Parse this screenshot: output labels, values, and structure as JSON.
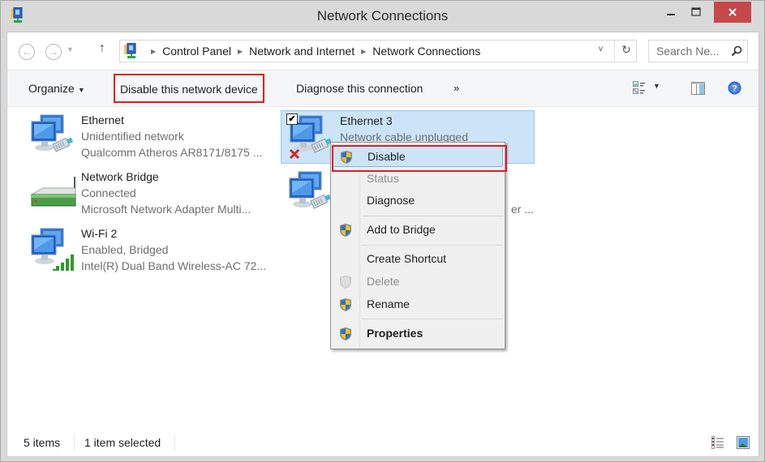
{
  "window": {
    "title": "Network Connections",
    "controls": {
      "minimize": "–",
      "maximize": "□",
      "close": "✕"
    },
    "close_color": "#c7484a"
  },
  "address": {
    "back_glyph": "←",
    "forward_glyph": "→",
    "recent_glyph": "▼",
    "up_glyph": "↑",
    "breadcrumbs": [
      "Control Panel",
      "Network and Internet",
      "Network Connections"
    ],
    "separator_glyph": "▶",
    "dropdown_glyph": "v",
    "refresh_glyph": "↻",
    "search_placeholder": "Search Ne..."
  },
  "toolbar": {
    "organize": "Organize",
    "disable": "Disable this network device",
    "diagnose": "Diagnose this connection",
    "more": "»",
    "caret": "▼",
    "highlight_color": "#e01b24"
  },
  "connections": [
    {
      "name": "Ethernet",
      "status": "Unidentified network",
      "device": "Qualcomm Atheros AR8171/8175 ...",
      "icon": "wired-network-icon",
      "selected": false
    },
    {
      "name": "Network Bridge",
      "status": "Connected",
      "device": "Microsoft Network Adapter Multi...",
      "icon": "network-bridge-icon",
      "selected": false
    },
    {
      "name": "Wi-Fi 2",
      "status": "Enabled, Bridged",
      "device": "Intel(R) Dual Band Wireless-AC 72...",
      "icon": "wireless-network-icon",
      "selected": false
    },
    {
      "name": "Ethernet 3",
      "status": "Network cable unplugged",
      "device": "",
      "icon": "wired-network-disconnected-icon",
      "selected": true,
      "check_glyph": "✔"
    },
    {
      "name": "",
      "status": "",
      "device": "er ...",
      "icon": "wired-network-icon",
      "selected": false
    }
  ],
  "context_menu": {
    "items": [
      {
        "label": "Disable",
        "shield": true,
        "disabled": false,
        "bold": false,
        "highlighted": true
      },
      {
        "label": "Status",
        "shield": false,
        "disabled": true,
        "bold": false
      },
      {
        "label": "Diagnose",
        "shield": false,
        "disabled": false,
        "bold": false
      },
      {
        "label": "Add to Bridge",
        "shield": true,
        "disabled": false,
        "bold": false
      },
      {
        "label": "Create Shortcut",
        "shield": false,
        "disabled": false,
        "bold": false
      },
      {
        "label": "Delete",
        "shield": true,
        "disabled": true,
        "bold": false
      },
      {
        "label": "Rename",
        "shield": true,
        "disabled": false,
        "bold": false
      },
      {
        "label": "Properties",
        "shield": true,
        "disabled": false,
        "bold": true
      }
    ]
  },
  "statusbar": {
    "count": "5 items",
    "selected": "1 item selected"
  }
}
